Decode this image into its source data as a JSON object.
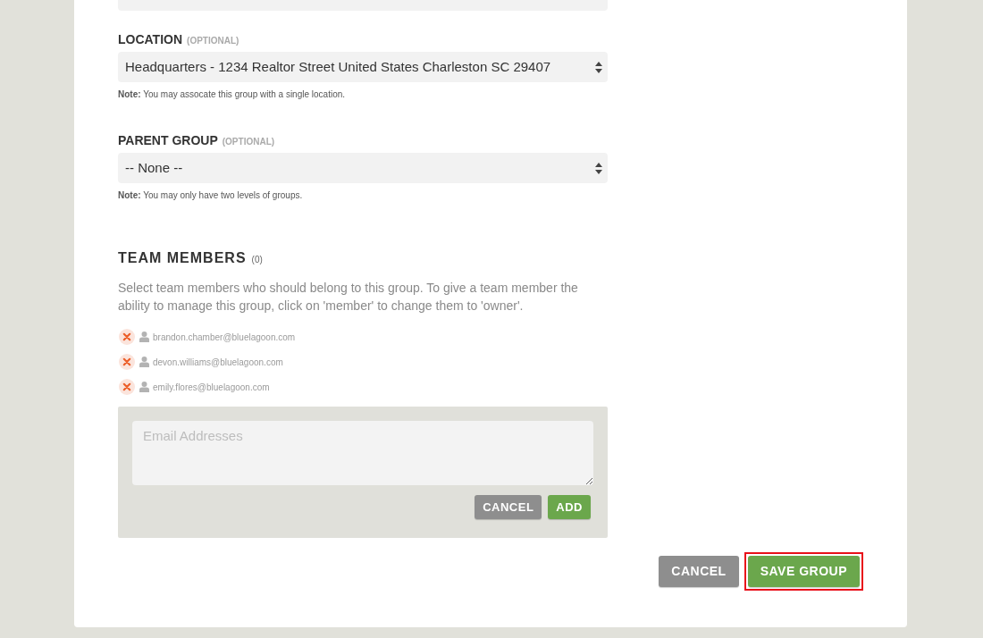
{
  "fields": [
    {
      "label": "LOCATION",
      "hint": "(OPTIONAL)",
      "value": "Headquarters - 1234 Realtor Street United States Charleston SC 29407",
      "note": "**Note:** You may assocate this group with a single location."
    },
    {
      "label": "PARENT GROUP",
      "hint": "(OPTIONAL)",
      "value": "-- None --",
      "note": "**Note:** You may only have two levels of groups."
    }
  ],
  "team_members": {
    "title": "TEAM MEMBERS",
    "count": "(0)",
    "description": "Select team members who should belong to this group. To give a team member the ability to manage this group, click on 'member' to change them to 'owner'.",
    "members": [
      {
        "email": "brandon.chamber@bluelagoon.com"
      },
      {
        "email": "devon.williams@bluelagoon.com"
      },
      {
        "email": "emily.flores@bluelagoon.com"
      }
    ],
    "add_form": {
      "placeholder": "Email Addresses",
      "buttons": [
        {
          "label": "CANCEL",
          "kind": "secondary"
        },
        {
          "label": "ADD",
          "kind": "primary"
        }
      ]
    }
  },
  "footer_buttons": [
    {
      "label": "CANCEL",
      "kind": "secondary",
      "highlighted": false
    },
    {
      "label": "SAVE GROUP",
      "kind": "primary",
      "highlighted": true
    }
  ]
}
